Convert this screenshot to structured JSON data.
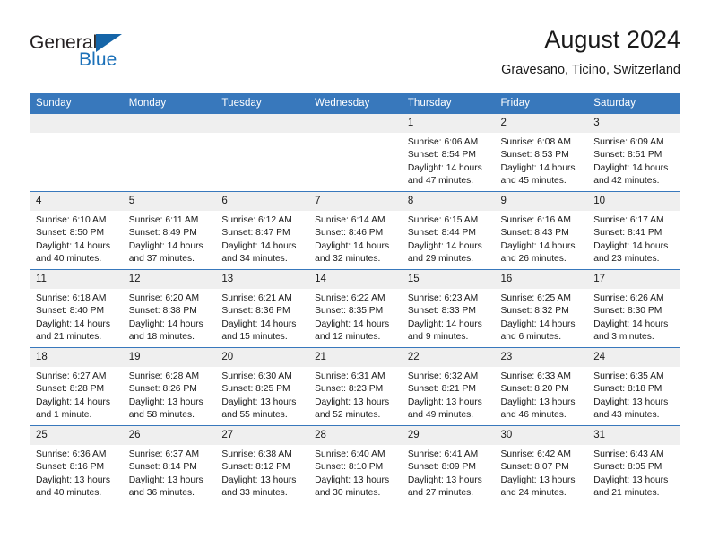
{
  "brand": {
    "name_part1": "General",
    "name_part2": "Blue",
    "triangle_color": "#1565a8"
  },
  "header": {
    "title": "August 2024",
    "subtitle": "Gravesano, Ticino, Switzerland"
  },
  "theme": {
    "header_blue": "#3878bc",
    "daynum_band": "#efefef",
    "text": "#1a1a1a"
  },
  "columns": [
    "Sunday",
    "Monday",
    "Tuesday",
    "Wednesday",
    "Thursday",
    "Friday",
    "Saturday"
  ],
  "labels": {
    "sunrise": "Sunrise:",
    "sunset": "Sunset:",
    "daylight": "Daylight:"
  },
  "weeks": [
    [
      {
        "day": "",
        "sunrise": "",
        "sunset": "",
        "daylight": "",
        "empty": true
      },
      {
        "day": "",
        "sunrise": "",
        "sunset": "",
        "daylight": "",
        "empty": true
      },
      {
        "day": "",
        "sunrise": "",
        "sunset": "",
        "daylight": "",
        "empty": true
      },
      {
        "day": "",
        "sunrise": "",
        "sunset": "",
        "daylight": "",
        "empty": true
      },
      {
        "day": "1",
        "sunrise": "Sunrise: 6:06 AM",
        "sunset": "Sunset: 8:54 PM",
        "daylight_l1": "Daylight: 14 hours",
        "daylight_l2": "and 47 minutes."
      },
      {
        "day": "2",
        "sunrise": "Sunrise: 6:08 AM",
        "sunset": "Sunset: 8:53 PM",
        "daylight_l1": "Daylight: 14 hours",
        "daylight_l2": "and 45 minutes."
      },
      {
        "day": "3",
        "sunrise": "Sunrise: 6:09 AM",
        "sunset": "Sunset: 8:51 PM",
        "daylight_l1": "Daylight: 14 hours",
        "daylight_l2": "and 42 minutes."
      }
    ],
    [
      {
        "day": "4",
        "sunrise": "Sunrise: 6:10 AM",
        "sunset": "Sunset: 8:50 PM",
        "daylight_l1": "Daylight: 14 hours",
        "daylight_l2": "and 40 minutes."
      },
      {
        "day": "5",
        "sunrise": "Sunrise: 6:11 AM",
        "sunset": "Sunset: 8:49 PM",
        "daylight_l1": "Daylight: 14 hours",
        "daylight_l2": "and 37 minutes."
      },
      {
        "day": "6",
        "sunrise": "Sunrise: 6:12 AM",
        "sunset": "Sunset: 8:47 PM",
        "daylight_l1": "Daylight: 14 hours",
        "daylight_l2": "and 34 minutes."
      },
      {
        "day": "7",
        "sunrise": "Sunrise: 6:14 AM",
        "sunset": "Sunset: 8:46 PM",
        "daylight_l1": "Daylight: 14 hours",
        "daylight_l2": "and 32 minutes."
      },
      {
        "day": "8",
        "sunrise": "Sunrise: 6:15 AM",
        "sunset": "Sunset: 8:44 PM",
        "daylight_l1": "Daylight: 14 hours",
        "daylight_l2": "and 29 minutes."
      },
      {
        "day": "9",
        "sunrise": "Sunrise: 6:16 AM",
        "sunset": "Sunset: 8:43 PM",
        "daylight_l1": "Daylight: 14 hours",
        "daylight_l2": "and 26 minutes."
      },
      {
        "day": "10",
        "sunrise": "Sunrise: 6:17 AM",
        "sunset": "Sunset: 8:41 PM",
        "daylight_l1": "Daylight: 14 hours",
        "daylight_l2": "and 23 minutes."
      }
    ],
    [
      {
        "day": "11",
        "sunrise": "Sunrise: 6:18 AM",
        "sunset": "Sunset: 8:40 PM",
        "daylight_l1": "Daylight: 14 hours",
        "daylight_l2": "and 21 minutes."
      },
      {
        "day": "12",
        "sunrise": "Sunrise: 6:20 AM",
        "sunset": "Sunset: 8:38 PM",
        "daylight_l1": "Daylight: 14 hours",
        "daylight_l2": "and 18 minutes."
      },
      {
        "day": "13",
        "sunrise": "Sunrise: 6:21 AM",
        "sunset": "Sunset: 8:36 PM",
        "daylight_l1": "Daylight: 14 hours",
        "daylight_l2": "and 15 minutes."
      },
      {
        "day": "14",
        "sunrise": "Sunrise: 6:22 AM",
        "sunset": "Sunset: 8:35 PM",
        "daylight_l1": "Daylight: 14 hours",
        "daylight_l2": "and 12 minutes."
      },
      {
        "day": "15",
        "sunrise": "Sunrise: 6:23 AM",
        "sunset": "Sunset: 8:33 PM",
        "daylight_l1": "Daylight: 14 hours",
        "daylight_l2": "and 9 minutes."
      },
      {
        "day": "16",
        "sunrise": "Sunrise: 6:25 AM",
        "sunset": "Sunset: 8:32 PM",
        "daylight_l1": "Daylight: 14 hours",
        "daylight_l2": "and 6 minutes."
      },
      {
        "day": "17",
        "sunrise": "Sunrise: 6:26 AM",
        "sunset": "Sunset: 8:30 PM",
        "daylight_l1": "Daylight: 14 hours",
        "daylight_l2": "and 3 minutes."
      }
    ],
    [
      {
        "day": "18",
        "sunrise": "Sunrise: 6:27 AM",
        "sunset": "Sunset: 8:28 PM",
        "daylight_l1": "Daylight: 14 hours",
        "daylight_l2": "and 1 minute."
      },
      {
        "day": "19",
        "sunrise": "Sunrise: 6:28 AM",
        "sunset": "Sunset: 8:26 PM",
        "daylight_l1": "Daylight: 13 hours",
        "daylight_l2": "and 58 minutes."
      },
      {
        "day": "20",
        "sunrise": "Sunrise: 6:30 AM",
        "sunset": "Sunset: 8:25 PM",
        "daylight_l1": "Daylight: 13 hours",
        "daylight_l2": "and 55 minutes."
      },
      {
        "day": "21",
        "sunrise": "Sunrise: 6:31 AM",
        "sunset": "Sunset: 8:23 PM",
        "daylight_l1": "Daylight: 13 hours",
        "daylight_l2": "and 52 minutes."
      },
      {
        "day": "22",
        "sunrise": "Sunrise: 6:32 AM",
        "sunset": "Sunset: 8:21 PM",
        "daylight_l1": "Daylight: 13 hours",
        "daylight_l2": "and 49 minutes."
      },
      {
        "day": "23",
        "sunrise": "Sunrise: 6:33 AM",
        "sunset": "Sunset: 8:20 PM",
        "daylight_l1": "Daylight: 13 hours",
        "daylight_l2": "and 46 minutes."
      },
      {
        "day": "24",
        "sunrise": "Sunrise: 6:35 AM",
        "sunset": "Sunset: 8:18 PM",
        "daylight_l1": "Daylight: 13 hours",
        "daylight_l2": "and 43 minutes."
      }
    ],
    [
      {
        "day": "25",
        "sunrise": "Sunrise: 6:36 AM",
        "sunset": "Sunset: 8:16 PM",
        "daylight_l1": "Daylight: 13 hours",
        "daylight_l2": "and 40 minutes."
      },
      {
        "day": "26",
        "sunrise": "Sunrise: 6:37 AM",
        "sunset": "Sunset: 8:14 PM",
        "daylight_l1": "Daylight: 13 hours",
        "daylight_l2": "and 36 minutes."
      },
      {
        "day": "27",
        "sunrise": "Sunrise: 6:38 AM",
        "sunset": "Sunset: 8:12 PM",
        "daylight_l1": "Daylight: 13 hours",
        "daylight_l2": "and 33 minutes."
      },
      {
        "day": "28",
        "sunrise": "Sunrise: 6:40 AM",
        "sunset": "Sunset: 8:10 PM",
        "daylight_l1": "Daylight: 13 hours",
        "daylight_l2": "and 30 minutes."
      },
      {
        "day": "29",
        "sunrise": "Sunrise: 6:41 AM",
        "sunset": "Sunset: 8:09 PM",
        "daylight_l1": "Daylight: 13 hours",
        "daylight_l2": "and 27 minutes."
      },
      {
        "day": "30",
        "sunrise": "Sunrise: 6:42 AM",
        "sunset": "Sunset: 8:07 PM",
        "daylight_l1": "Daylight: 13 hours",
        "daylight_l2": "and 24 minutes."
      },
      {
        "day": "31",
        "sunrise": "Sunrise: 6:43 AM",
        "sunset": "Sunset: 8:05 PM",
        "daylight_l1": "Daylight: 13 hours",
        "daylight_l2": "and 21 minutes."
      }
    ]
  ]
}
